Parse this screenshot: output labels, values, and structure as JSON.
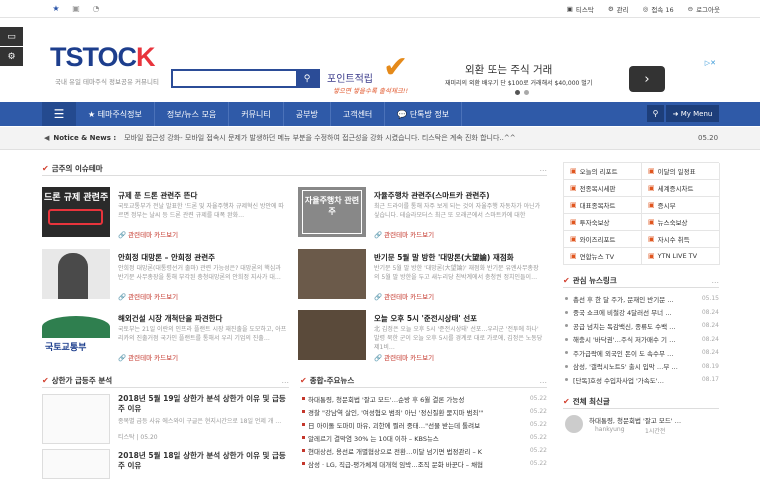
{
  "topbar": {
    "links": [
      "티스탁",
      "관리",
      "접속 16",
      "로그아웃"
    ]
  },
  "header": {
    "logo_main": "TSTOC",
    "logo_accent": "K",
    "logo_sub": "국내 유일 테마주식 정보공유 커뮤니티",
    "promo_title": "포인트적립",
    "promo_sub": "쌓으면 쌓을수록 출석체크!!",
    "ad_title": "외환 또는 주식 거래",
    "ad_sub": "재미리의 외환 배우기 단 $100로 거래해서 $40,000 벌기"
  },
  "nav": {
    "items": [
      "테마주식정보",
      "정보/뉴스 모음",
      "커뮤니티",
      "공부방",
      "고객센터",
      "단톡방 정보"
    ],
    "my_menu": "My Menu"
  },
  "notice": {
    "label": "Notice & News :",
    "text": "모바일 접근성 강화- 모바일 접속시 문제가 발생하던 메뉴 부분을 수정하여 접근성을 강화 시켰습니다. 티스탁은 계속 진화 합니다..^^",
    "date": "05.20"
  },
  "main_section": {
    "title": "금주의 이슈테마",
    "cards": [
      {
        "img_label": "드론 규제 관련주",
        "title": "규제 푼 드론 관련주 뜬다",
        "desc": "국토교통부가 전날 발표한 '드론 및 자율주행차 규제혁신 방안에 따르면 정부는 날씨 등 드론 관련 규제를 대폭 완화…",
        "tag": "관련테마 카드보기"
      },
      {
        "img_label": "자율주행차 관련주",
        "title": "자율주행차 관련주(스마트카 관련주)",
        "desc": "최근 드라이를 통해 자주 보게 되는 것이 자율주행 자동차가 아닌가 싶습니다. 테슬라모터스 최근 또 오래곤에서 스마트카에 대한",
        "tag": "관련테마 카드보기"
      },
      {
        "img_label": "",
        "title": "안희정 대망론 – 안희정 관련주",
        "desc": "안희정 대망론(대통령선거 출마) 관련 가능성은? 대망론의 핵심과 반기문 사무총장을 통해 부각된 충청대망론의 안희정 지사가 대…",
        "tag": "관련테마 카드보기"
      },
      {
        "img_label": "",
        "title": "반기문 5월 말 방한 '대망론(大望論) 재점화",
        "desc": "반기문 5월 말 방한 '대망론(大望論)' 재점화 반기문 유엔사무총장의 5월 말 방한을 두고 새누리당 친박계에서 충청권 정치인들이…",
        "tag": "관련테마 카드보기"
      },
      {
        "img_label": "국토교통부",
        "title": "해외건설 시장 개척단을 파견한다",
        "desc": "국토부는 21일 이란의 인프라 플랜트 시장 재진출을 도모하고, 아프리카의 진출거점 국가인 플랜트를 통해서 우리 기업의 진출…",
        "tag": "관련테마 카드보기"
      },
      {
        "img_label": "",
        "title": "오늘 오후 5시 '준전시상태' 선포",
        "desc": "北 김정은 오늘 오후 5시 '준전시상태' 선포…우리군 '전투에 하나' 발령 북한 군이 오늘 오후 5시를 경계로 대로 가로에, 김정은 노동당 제1비…",
        "tag": "관련테마 카드보기"
      }
    ]
  },
  "right_links": {
    "items": [
      "오늘의 리포트",
      "이달의 일정표",
      "전종목시세판",
      "세계증시차트",
      "대표종목차트",
      "증시부",
      "투자숙보상",
      "뉴스숙보상",
      "와이즈리포트",
      "자시수 취득",
      "연합뉴스 TV",
      "YTN LIVE TV"
    ]
  },
  "related_news": {
    "title": "관심 뉴스링크",
    "items": [
      {
        "text": "총선 후 한 달 주가, 문재인 반기문 …",
        "date": "05.15"
      },
      {
        "text": "중국 쇼크에 비철강 4달러선 무너 …",
        "date": "08.24"
      },
      {
        "text": "공급 넘치는 독감백신, 종류도 수백 …",
        "date": "08.24"
      },
      {
        "text": "해충시 '바닥권'…주식 저가매수 기 …",
        "date": "08.24"
      },
      {
        "text": "주가급락에 외국인 돈이 도 속수무 …",
        "date": "08.24"
      },
      {
        "text": "삼성, '갤럭시노트5' 출시 입막 …부 …",
        "date": "08.19"
      },
      {
        "text": "[단독]호성 수입차사업 '가속도'…",
        "date": "08.17"
      }
    ]
  },
  "upper_analysis": {
    "title": "상한가 급등주 분석",
    "items": [
      {
        "title": "2018년 5월 19일 상한가 분석 상한가 이유 및 급등주 이유",
        "desc": "종목별 급등 사유 에스와이 구글은 현지시간으로 18일 언제 개 …",
        "meta": "티스탁 | 05.20"
      },
      {
        "title": "2018년 5월 18일 상한가 분석 상한가 이유 및 급등주 이유",
        "desc": "",
        "meta": ""
      }
    ]
  },
  "general_news": {
    "title": "종합-주요뉴스",
    "items": [
      {
        "text": "하대통령, 청문회법 '잘고 모드'…순방 후 6월 결론 가능성",
        "date": "05.22"
      },
      {
        "text": "경찰 \"강남역 살인, '여성혐오 범죄' 아닌 '정신질환 묻지마 범죄'\"",
        "date": "05.22"
      },
      {
        "text": "日 아이돌 도마미 마유, 괴한에 찔러 중태…\"선물 받는데 톨려보",
        "date": "05.22"
      },
      {
        "text": "알레르기 결막염 30% 는 10대 이하 – KBS뉴스",
        "date": "05.22"
      },
      {
        "text": "현대상선, 용선료 개별협상으로 전환…이달 넘기면 법정관리 – K",
        "date": "05.22"
      },
      {
        "text": "삼성 · LG, 직급-평가체계 대개혁 임박…조직 문화 바꾼다 – 채협",
        "date": "05.22"
      }
    ]
  },
  "comments": {
    "title": "전체 최신글",
    "items": [
      {
        "text": "하대통령, 청문회법 '잘고 모드' …",
        "user": "hankyung",
        "time": "1시간전"
      }
    ]
  }
}
